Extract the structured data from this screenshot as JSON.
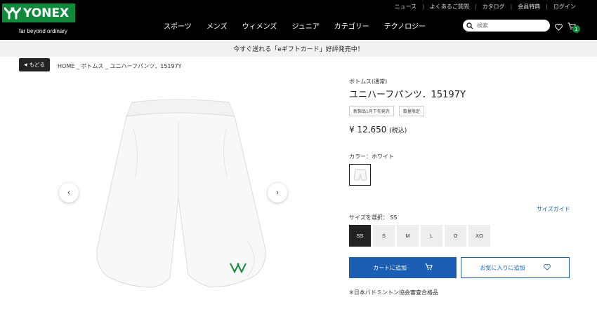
{
  "brand": {
    "name": "YONEX",
    "tagline": "far beyond ordinary",
    "color": "#0f8a3a"
  },
  "utility_nav": [
    "ニュース",
    "よくあるご質問",
    "カタログ",
    "会員特典",
    "ログイン"
  ],
  "main_nav": [
    "スポーツ",
    "メンズ",
    "ウィメンズ",
    "ジュニア",
    "カテゴリー",
    "テクノロジー"
  ],
  "search": {
    "placeholder": "検索"
  },
  "cart": {
    "count": "1"
  },
  "banner": {
    "text": "今すぐ送れる「eギフトカード」好評発売中！"
  },
  "back_button": "もどる",
  "breadcrumb": "HOME _ ボトムス _ ユニハーフパンツ．15197Y",
  "product": {
    "category": "ボトムス(通常)",
    "title": "ユニハーフパンツ．15197Y",
    "tags": [
      "新製品1月下旬発売",
      "数量限定"
    ],
    "price": "¥ 12,650",
    "tax_note": "(税込)",
    "color_label": "カラー：ホワイト",
    "size_guide": "サイズガイド",
    "size_label": "サイズを選択： SS",
    "sizes": [
      "SS",
      "S",
      "M",
      "L",
      "O",
      "XO"
    ],
    "add_to_cart": "カートに追加",
    "add_to_favorites": "お気に入りに追加",
    "note": "※日本バドミントン協会審査合格品"
  },
  "accent_color": "#1a5fb4"
}
